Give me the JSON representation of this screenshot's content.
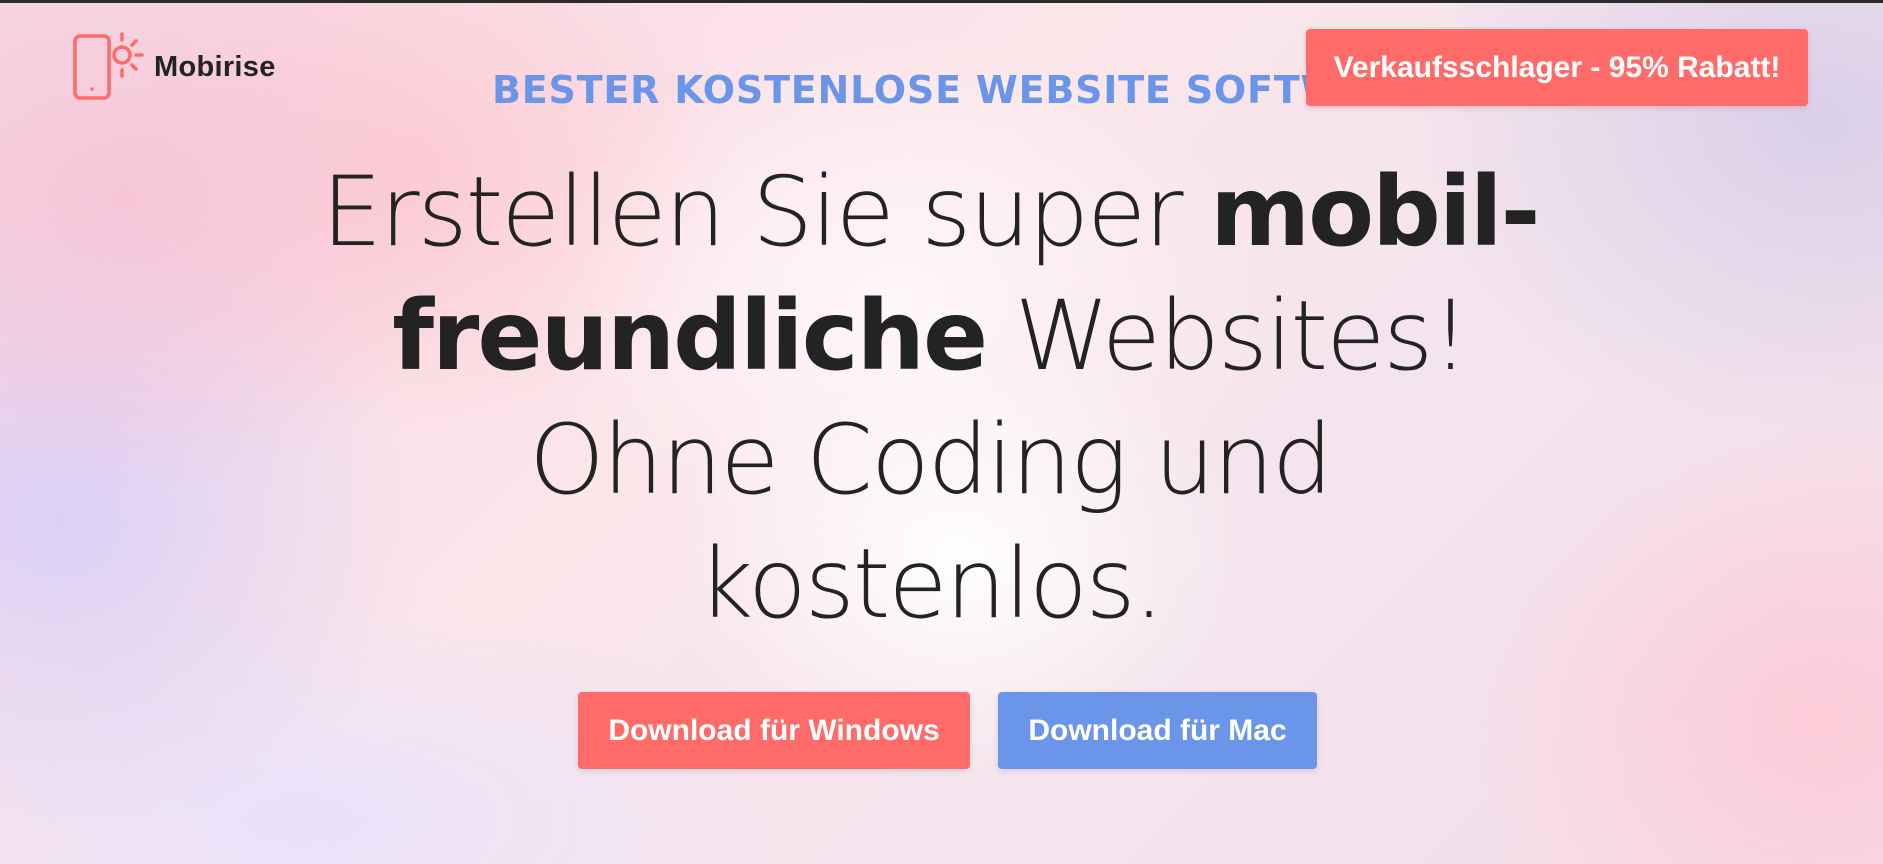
{
  "colors": {
    "accent_coral": "#ff6b69",
    "accent_blue": "#6b95e8",
    "text_dark": "#232323"
  },
  "header": {
    "brand_name": "Mobirise",
    "logo_icon": "phone-sun-icon",
    "eyebrow": "BESTER KOSTENLOSE WEBSITE SOFTW",
    "promo_label": "Verkaufsschlager - 95% Rabatt!"
  },
  "hero": {
    "line1_regular": "Erstellen Sie super ",
    "line1_bold": "mobil-",
    "line2_bold": "freundliche",
    "line2_regular": " Websites!",
    "line3": "Ohne Coding und",
    "line4": "kostenlos."
  },
  "cta": {
    "windows_label": "Download für Windows",
    "mac_label": "Download für Mac"
  }
}
